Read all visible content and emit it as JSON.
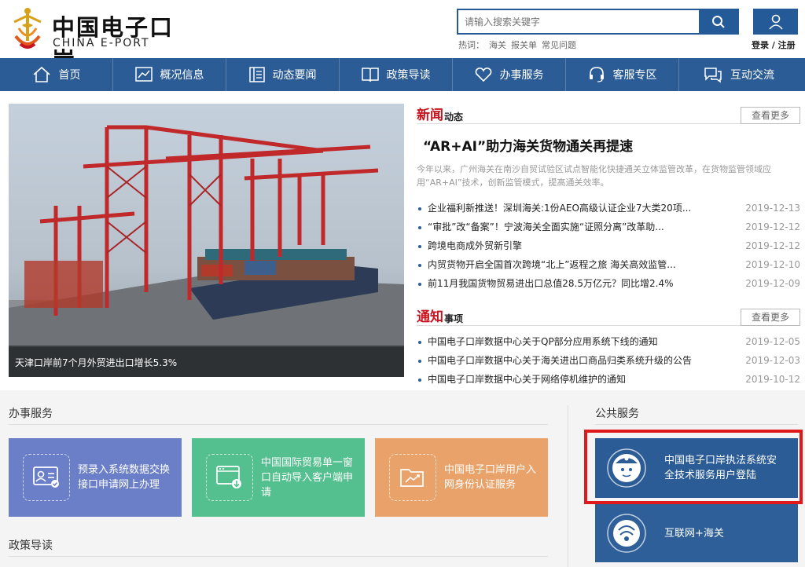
{
  "header": {
    "logo_cn": "中国电子口岸",
    "logo_en": "CHINA E-PORT",
    "search_placeholder": "请输入搜索关键字",
    "hot_label": "热词：",
    "hot_words": [
      "海关",
      "报关单",
      "常见问题"
    ],
    "login_label": "登录 / 注册"
  },
  "nav": {
    "items": [
      {
        "label": "首页",
        "icon": "home-icon"
      },
      {
        "label": "概况信息",
        "icon": "chart-icon"
      },
      {
        "label": "动态要闻",
        "icon": "news-icon"
      },
      {
        "label": "政策导读",
        "icon": "book-icon"
      },
      {
        "label": "办事服务",
        "icon": "heart-icon"
      },
      {
        "label": "客服专区",
        "icon": "headset-icon"
      },
      {
        "label": "互动交流",
        "icon": "chat-icon"
      }
    ]
  },
  "banner": {
    "caption": "天津口岸前7个月外贸进出口增长5.3%"
  },
  "news": {
    "title_red": "新闻",
    "title_black": "动态",
    "more": "查看更多",
    "headline": "“AR+AI”助力海关货物通关再提速",
    "summary": "今年以来，广州海关在南沙自贸试验区试点智能化快捷通关立体监管改革，在货物监管领域应用“AR+AI”技术，创新监管模式，提高通关效率。",
    "items": [
      {
        "title": "企业福利新推送！深圳海关:1份AEO高级认证企业7大类20项...",
        "date": "2019-12-13"
      },
      {
        "title": "“审批”改“备案”！宁波海关全面实施“证照分离”改革助...",
        "date": "2019-12-12"
      },
      {
        "title": "跨境电商成外贸新引擎",
        "date": "2019-12-12"
      },
      {
        "title": "内贸货物开启全国首次跨境“北上”返程之旅 海关高效监管...",
        "date": "2019-12-10"
      },
      {
        "title": "前11月我国货物贸易进出口总值28.5万亿元？同比增2.4%",
        "date": "2019-12-09"
      }
    ]
  },
  "notice": {
    "title_red": "通知",
    "title_black": "事项",
    "more": "查看更多",
    "items": [
      {
        "title": "中国电子口岸数据中心关于QP部分应用系统下线的通知",
        "date": "2019-12-05"
      },
      {
        "title": "中国电子口岸数据中心关于海关进出口商品归类系统升级的公告",
        "date": "2019-12-03"
      },
      {
        "title": "中国电子口岸数据中心关于网络停机维护的通知",
        "date": "2019-10-12"
      }
    ]
  },
  "services": {
    "title": "办事服务",
    "cards": [
      {
        "text": "预录入系统数据交换接口申请网上办理",
        "color": "#6b7fc9"
      },
      {
        "text": "中国国际贸易单一窗口自动导入客户端申请",
        "color": "#55c08f"
      },
      {
        "text": "中国电子口岸用户入网身份认证服务",
        "color": "#e9a36a"
      }
    ]
  },
  "public": {
    "title": "公共服务",
    "items": [
      {
        "text": "中国电子口岸执法系统安全技术服务用户登陆"
      },
      {
        "text": "互联网+海关"
      }
    ]
  },
  "policy": {
    "title": "政策导读"
  }
}
